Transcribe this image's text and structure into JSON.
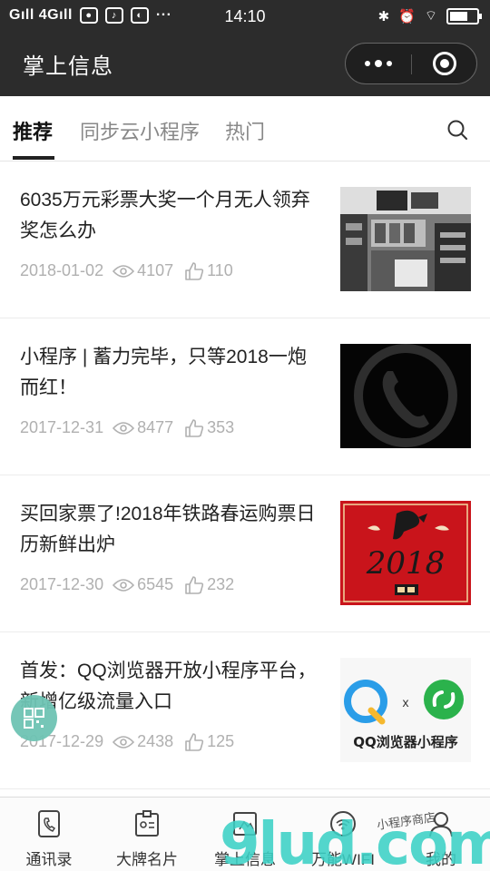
{
  "status_bar": {
    "signal": "Gıll 4Gıll",
    "dots": "···",
    "time": "14:10"
  },
  "nav": {
    "title": "掌上信息"
  },
  "tabs": [
    {
      "label": "推荐",
      "active": true
    },
    {
      "label": "同步云小程序",
      "active": false
    },
    {
      "label": "热门",
      "active": false
    }
  ],
  "articles": [
    {
      "title": "6035万元彩票大奖一个月无人领弃奖怎么办",
      "date": "2018-01-02",
      "views": "4107",
      "likes": "110",
      "thumb": "photo-store"
    },
    {
      "title": "小程序 | 蓄力完毕，只等2018一炮而红！",
      "date": "2017-12-31",
      "views": "8477",
      "likes": "353",
      "thumb": "phone-black"
    },
    {
      "title": "买回家票了!2018年铁路春运购票日历新鲜出炉",
      "date": "2017-12-30",
      "views": "6545",
      "likes": "232",
      "thumb": "red-2018"
    },
    {
      "title": "首发：QQ浏览器开放小程序平台，新增亿级流量入口",
      "date": "2017-12-29",
      "views": "2438",
      "likes": "125",
      "thumb": "qq-browser"
    }
  ],
  "thumb_text": {
    "year": "2018",
    "qq_caption": "QQ浏览器小程序",
    "x_mark": "x"
  },
  "tabbar": [
    {
      "label": "通讯录",
      "icon": "contacts-icon"
    },
    {
      "label": "大牌名片",
      "icon": "card-icon"
    },
    {
      "label": "掌上信息",
      "icon": "info-icon"
    },
    {
      "label": "万能WIFI",
      "icon": "wifi-icon"
    },
    {
      "label": "我的",
      "icon": "user-icon"
    }
  ],
  "watermark": {
    "logo": "9lud.com",
    "tag": "小程序商店"
  },
  "colors": {
    "header": "#2c2c2c",
    "fab": "#6ec4b4",
    "watermark": "#3bd0c5"
  }
}
